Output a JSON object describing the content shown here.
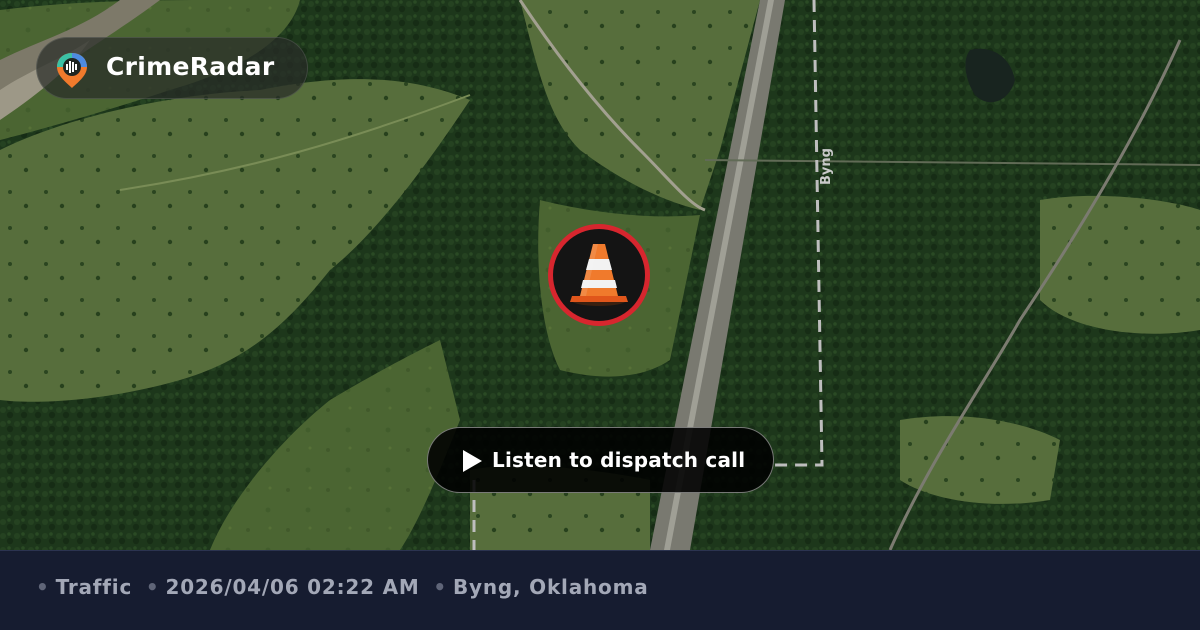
{
  "brand": {
    "name": "CrimeRadar",
    "logo_icon": "radar-pin-icon"
  },
  "map": {
    "road_label": "Byng",
    "marker_icon": "traffic-cone-icon",
    "colors": {
      "forest": "#1f3a1d",
      "field": "#4a6a33",
      "pasture": "#5e7a3e",
      "highway": "#9a9a8e",
      "marker_ring": "#d7262e"
    }
  },
  "cta": {
    "label": "Listen to dispatch call",
    "icon": "play-icon"
  },
  "footer": {
    "category": "Traffic",
    "datetime": "2026/04/06 02:22 AM",
    "location": "Byng, Oklahoma",
    "separator": "•"
  }
}
